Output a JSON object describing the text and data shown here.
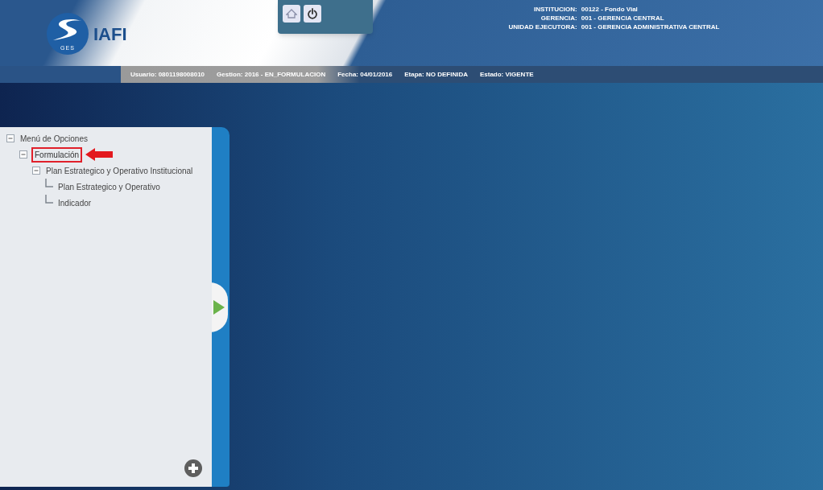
{
  "logo": {
    "letters": "IAFI",
    "sub": "GES"
  },
  "institution": [
    {
      "label": "INSTITUCION:",
      "value": "00122 - Fondo Vial"
    },
    {
      "label": "GERENCIA:",
      "value": "001 - GERENCIA CENTRAL"
    },
    {
      "label": "UNIDAD EJECUTORA:",
      "value": "001 - GERENCIA ADMINISTRATIVA CENTRAL"
    }
  ],
  "info_bar": [
    "Usuario: 0801198008010",
    "Gestion: 2016 - EN_FORMULACION",
    "Fecha: 04/01/2016",
    "Etapa: NO DEFINIDA",
    "Estado: VIGENTE"
  ],
  "menu": {
    "label": "Menú de Opciones",
    "expanded": true,
    "highlighted": false,
    "children": [
      {
        "label": "Formulación",
        "expanded": true,
        "highlighted": true,
        "children": [
          {
            "label": "Plan Estrategico y Operativo Institucional",
            "expanded": true,
            "highlighted": false,
            "children": [
              {
                "label": "Plan Estrategico y Operativo",
                "highlighted": false
              },
              {
                "label": "Indicador",
                "highlighted": false
              }
            ]
          }
        ]
      }
    ]
  }
}
